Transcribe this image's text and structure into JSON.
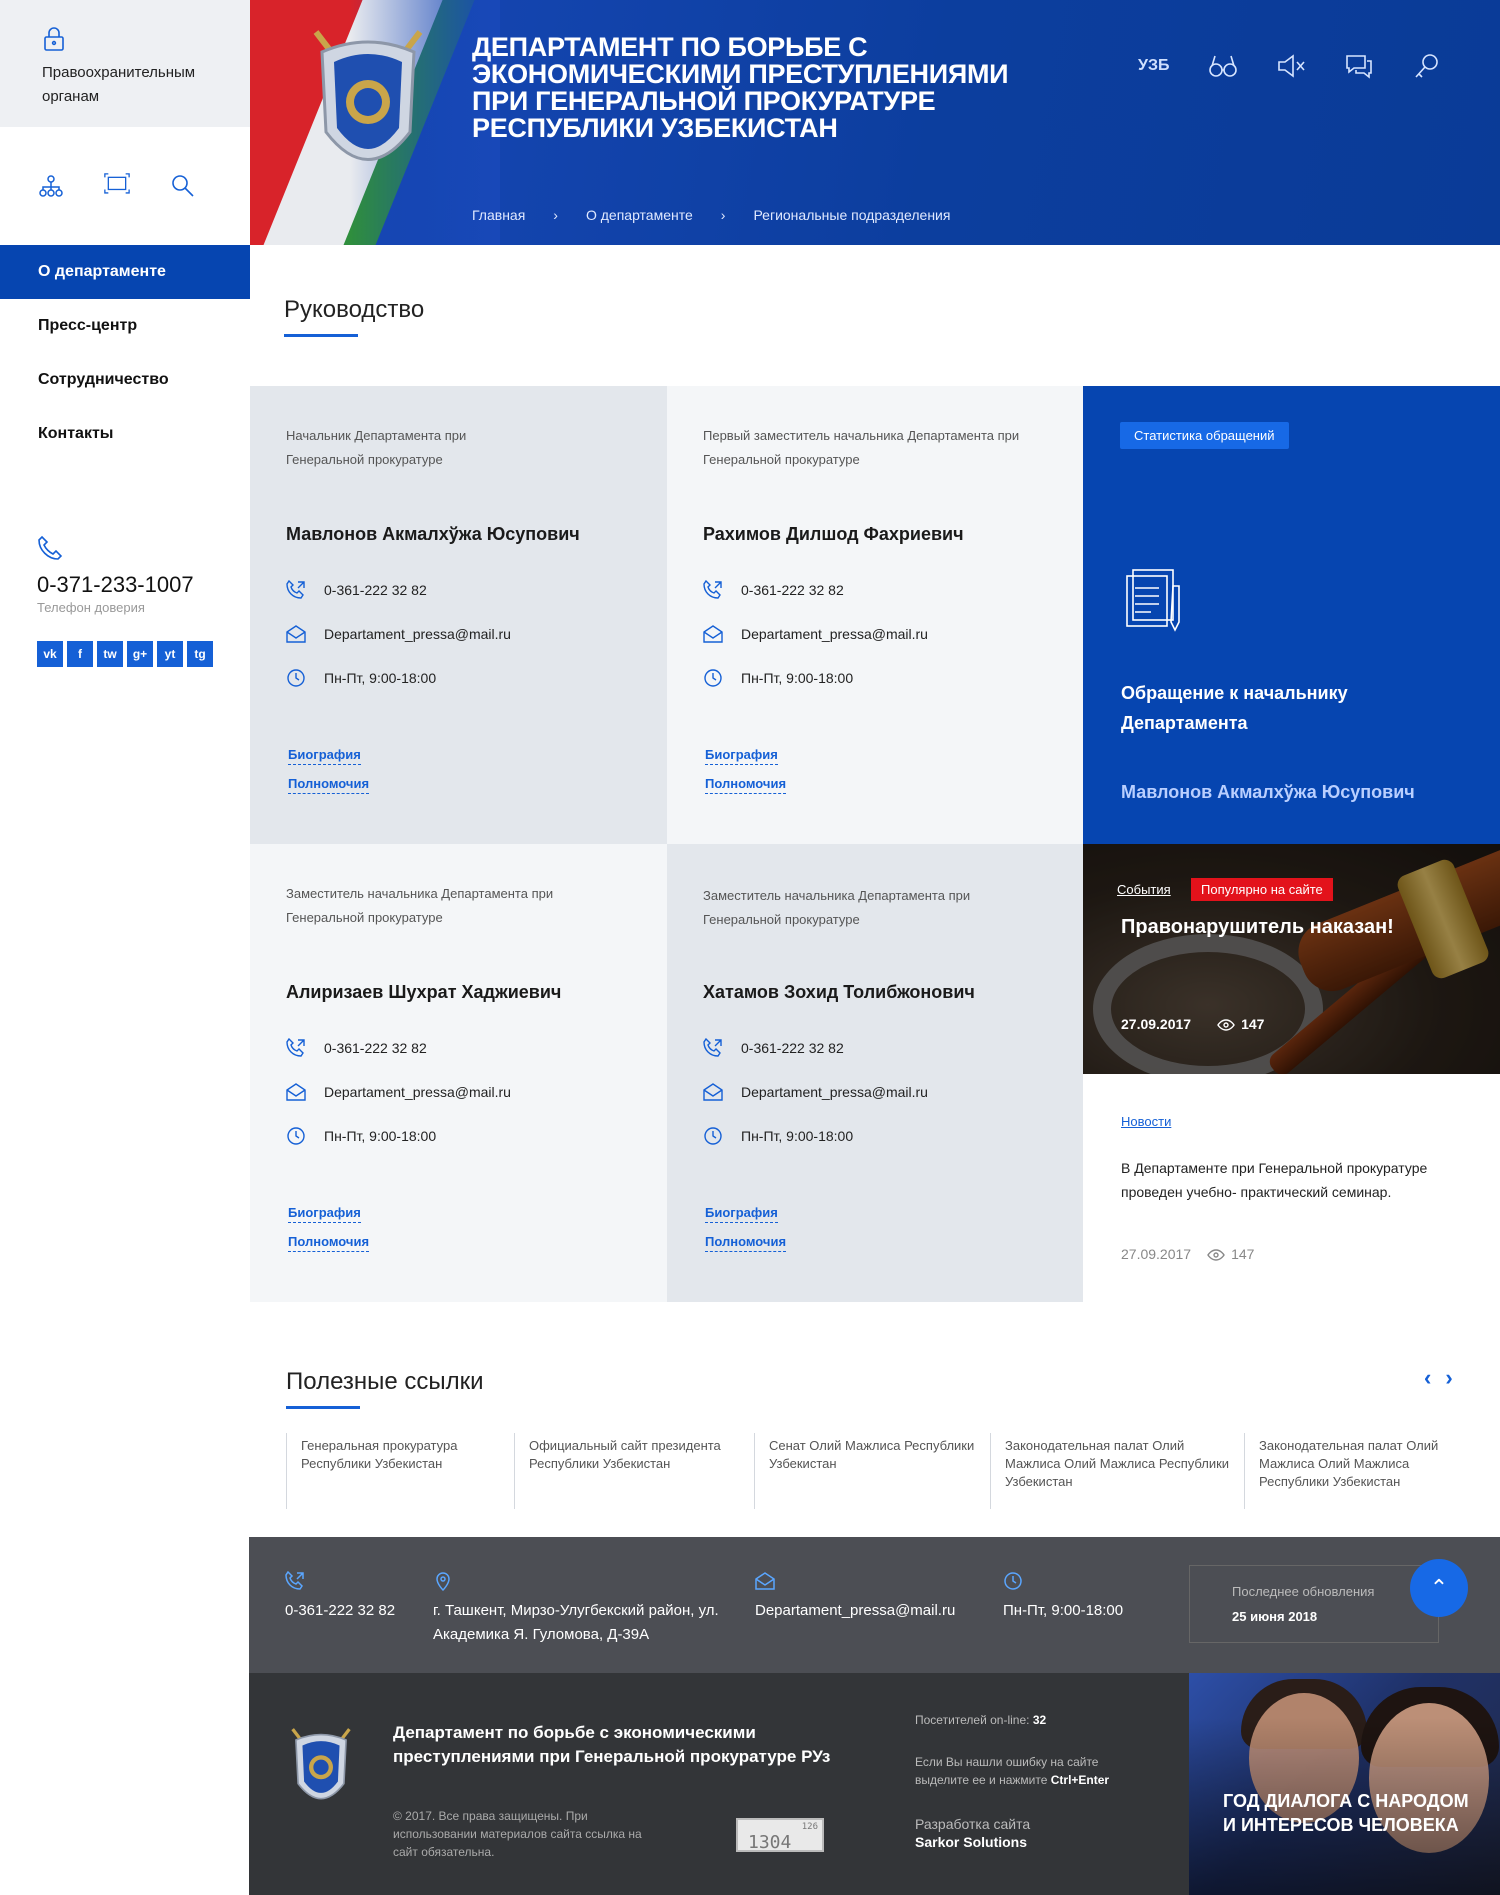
{
  "sidebar": {
    "top_link": "Правоохранительным органам",
    "nav": [
      {
        "label": "О департаменте"
      },
      {
        "label": "Пресс-центр"
      },
      {
        "label": "Сотрудничество"
      },
      {
        "label": "Контакты"
      }
    ],
    "phone": "0-371-233-1007",
    "phone_label": "Телефон доверия",
    "socials": [
      "vk",
      "f",
      "tw",
      "g+",
      "yt",
      "tg"
    ]
  },
  "header": {
    "title": "Департамент по борьбе с экономическими преступлениями при Генеральной прокуратуре Республики Узбекистан",
    "lang": "УЗБ",
    "breadcrumb": [
      "Главная",
      "О департаменте",
      "Региональные подразделения"
    ]
  },
  "leadership": {
    "title": "Руководство",
    "cards": [
      {
        "position": "Начальник Департамента при Генеральной прокуратуре",
        "name": "Мавлонов Акмалхўжа Юсупович",
        "phone": "0-361-222 32 82",
        "email": "Departament_pressa@mail.ru",
        "hours": "Пн-Пт,  9:00-18:00",
        "bio": "Биография",
        "powers": "Полномочия"
      },
      {
        "position": "Первый заместитель начальника Департамента при Генеральной прокуратуре",
        "name": "Рахимов Дилшод Фахриевич",
        "phone": "0-361-222 32 82",
        "email": "Departament_pressa@mail.ru",
        "hours": "Пн-Пт,  9:00-18:00",
        "bio": "Биография",
        "powers": "Полномочия"
      },
      {
        "position": "Заместитель начальника Департамента при Генеральной прокуратуре",
        "name": "Алиризаев Шухрат Хаджиевич",
        "phone": "0-361-222 32 82",
        "email": "Departament_pressa@mail.ru",
        "hours": "Пн-Пт,  9:00-18:00",
        "bio": "Биография",
        "powers": "Полномочия"
      },
      {
        "position": "Заместитель начальника Департамента при Генеральной прокуратуре",
        "name": "Хатамов Зохид Толибжонович",
        "phone": "0-361-222 32 82",
        "email": "Departament_pressa@mail.ru",
        "hours": "Пн-Пт,  9:00-18:00",
        "bio": "Биография",
        "powers": "Полномочия"
      }
    ]
  },
  "stat_card": {
    "badge": "Статистика обращений",
    "title": "Обращение к начальнику Департамента",
    "name": "Мавлонов Акмалхўжа Юсупович"
  },
  "news_feature": {
    "category": "События",
    "badge": "Популярно на сайте",
    "headline": "Правонарушитель наказан!",
    "date": "27.09.2017",
    "views": "147"
  },
  "news_item": {
    "category": "Новости",
    "text": "В Департаменте при Генеральной прокуратуре проведен учебно- практический семинар.",
    "date": "27.09.2017",
    "views": "147"
  },
  "useful_links": {
    "title": "Полезные ссылки",
    "items": [
      "Генеральная прокуратура Республики Узбекистан",
      "Официальный сайт президента Республики Узбекистан",
      "Сенат Олий Мажлиса Республики Узбекистан",
      "Законодательная палат Олий Мажлиса Олий Мажлиса Республики Узбекистан",
      "Законодательная палат Олий Мажлиса Олий Мажлиса Республики Узбекистан"
    ]
  },
  "footer": {
    "phone": "0-361-222 32 82",
    "address": "г. Ташкент, Мирзо-Улугбекский район, ул. Академика Я. Гуломова,  Д-39А",
    "email": "Departament_pressa@mail.ru",
    "hours": "Пн-Пт,  9:00-18:00",
    "last_update_label": "Последнее обновления",
    "last_update_date": "25 июня 2018",
    "org": "Департамент по борьбе с экономическими преступлениями при Генеральной прокуратуре РУз",
    "copyright": "© 2017. Все права защищены. При использовании материалов сайта ссылка на сайт обязательна.",
    "counter_main": "1304",
    "counter_small": "126",
    "online_label": "Посетителей on-line:",
    "online_count": "32",
    "error_text": "Если Вы нашли ошибку на сайте выделите ее и нажмите",
    "error_keys": "Ctrl+Enter",
    "dev_label": "Разработка сайта",
    "dev_name": "Sarkor Solutions",
    "promo": "Год диалога с народом и интересов человека"
  },
  "colors": {
    "brand": "#0645b0",
    "accent": "#1560d6",
    "alert": "#e3121b"
  }
}
